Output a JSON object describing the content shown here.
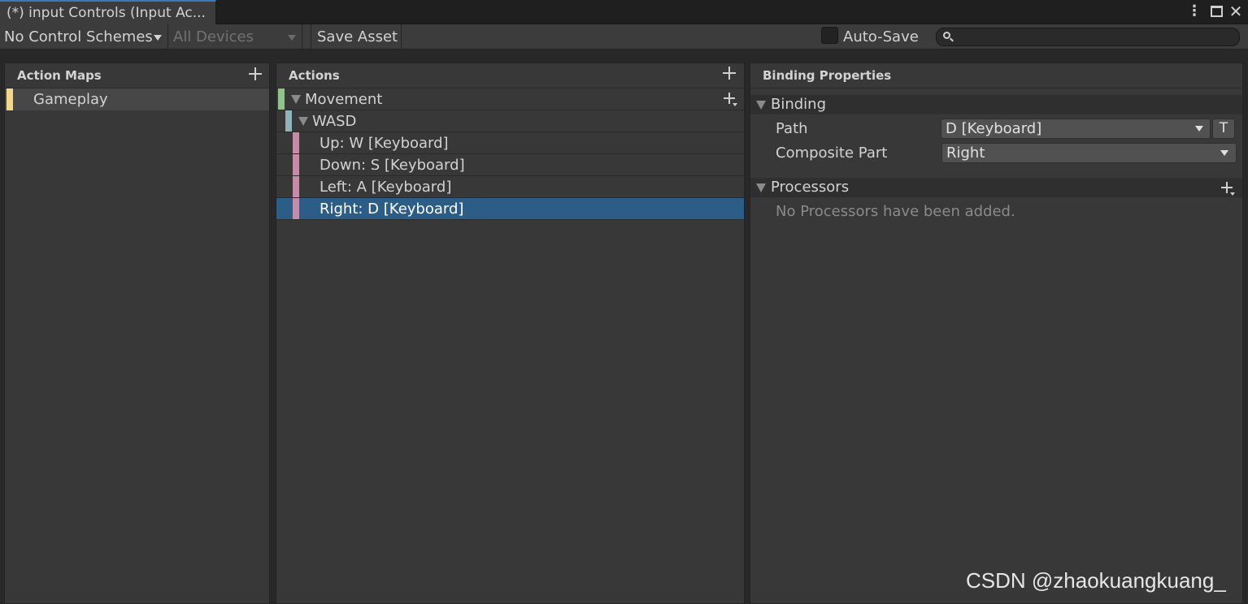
{
  "window": {
    "tab_title": "(*) input Controls (Input Ac...",
    "menu_icon": "more-vertical-icon",
    "maximize_icon": "maximize-icon",
    "close_icon": "close-icon",
    "close_glyph": "✕",
    "menu_glyph": "⋮"
  },
  "toolbar": {
    "control_schemes": "No Control Schemes",
    "devices": "All Devices",
    "save_asset": "Save Asset",
    "auto_save_label": "Auto-Save",
    "auto_save_checked": false,
    "search_value": "",
    "search_placeholder": ""
  },
  "action_maps": {
    "title": "Action Maps",
    "items": [
      {
        "label": "Gameplay",
        "color": "#f4d88a",
        "selected": false
      }
    ]
  },
  "actions": {
    "title": "Actions",
    "tree": [
      {
        "label": "Movement",
        "level": 0,
        "color": "#8fc38a",
        "expanded": true
      },
      {
        "label": "WASD",
        "level": 1,
        "color": "#8fb3b8",
        "expanded": true
      },
      {
        "label": "Up: W [Keyboard]",
        "level": 2,
        "color": "#c78ba7"
      },
      {
        "label": "Down: S [Keyboard]",
        "level": 2,
        "color": "#c78ba7"
      },
      {
        "label": "Left: A [Keyboard]",
        "level": 2,
        "color": "#c78ba7"
      },
      {
        "label": "Right: D [Keyboard]",
        "level": 2,
        "color": "#c78ba7",
        "selected": true
      }
    ],
    "selected_color": "#2c5d87"
  },
  "binding_properties": {
    "title": "Binding Properties",
    "binding_section": "Binding",
    "path_label": "Path",
    "path_value": "D [Keyboard]",
    "t_button": "T",
    "composite_label": "Composite Part",
    "composite_value": "Right",
    "processors_section": "Processors",
    "processors_empty": "No Processors have been added."
  },
  "watermark": "CSDN @zhaokuangkuang_"
}
